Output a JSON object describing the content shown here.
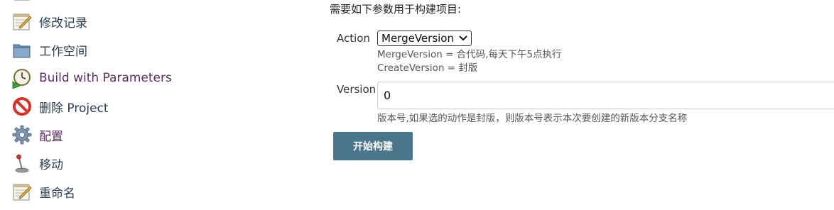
{
  "sidebar": {
    "items": [
      {
        "label": "修改记录",
        "icon": "notepad-icon"
      },
      {
        "label": "工作空间",
        "icon": "folder-icon"
      },
      {
        "label": "Build with Parameters",
        "icon": "clock-play-icon"
      },
      {
        "label": "删除 Project",
        "icon": "no-entry-icon"
      },
      {
        "label": "配置",
        "icon": "gear-icon"
      },
      {
        "label": "移动",
        "icon": "joystick-icon"
      },
      {
        "label": "重命名",
        "icon": "notepad-icon"
      }
    ]
  },
  "form": {
    "intro": "需要如下参数用于构建项目:",
    "action": {
      "label": "Action",
      "selected": "MergeVersion",
      "help": [
        "MergeVersion = 合代码,每天下午5点执行",
        "CreateVersion = 封版"
      ]
    },
    "version": {
      "label": "Version",
      "value": "0",
      "help": "版本号,如果选的动作是封版，则版本号表示本次要创建的新版本分支名称"
    },
    "submit_label": "开始构建"
  },
  "colors": {
    "link": "#2c3d52",
    "visited_link": "#5b2d62",
    "button_bg": "#4b758b"
  }
}
